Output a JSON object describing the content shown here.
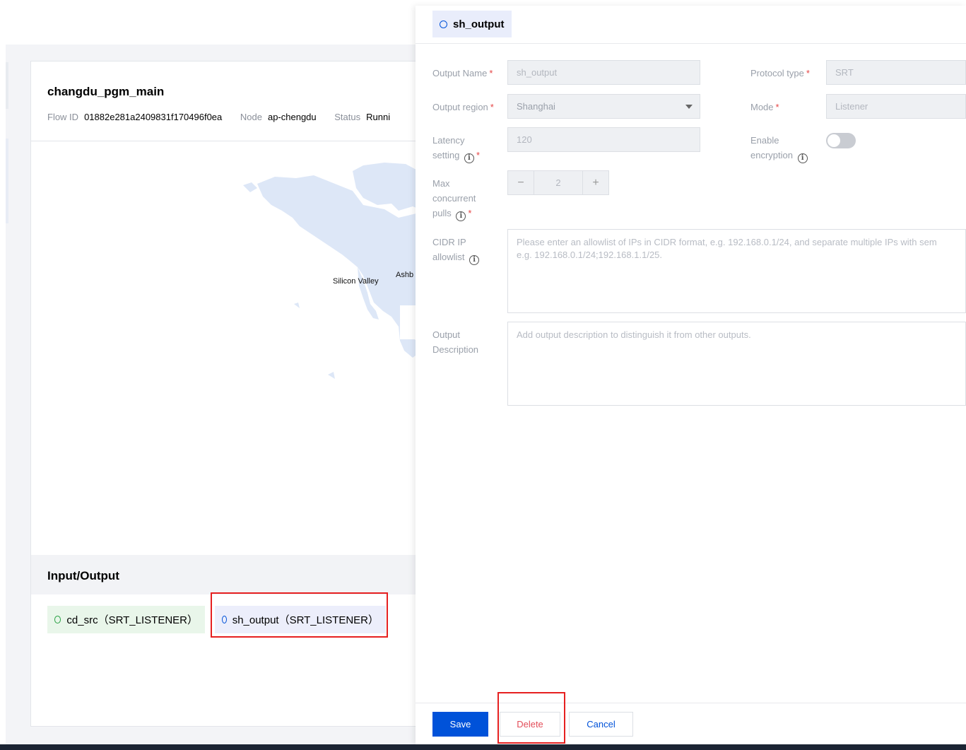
{
  "flow": {
    "title": "changdu_pgm_main",
    "flow_id_label": "Flow ID",
    "flow_id": "01882e281a2409831f170496f0ea",
    "node_label": "Node",
    "node": "ap-chengdu",
    "status_label": "Status",
    "status": "Runni"
  },
  "map": {
    "labels": [
      "Silicon Valley",
      "Ashb"
    ]
  },
  "io": {
    "title": "Input/Output",
    "input": "cd_src（SRT_LISTENER）",
    "output": "sh_output（SRT_LISTENER）"
  },
  "drawer": {
    "tab_label": "sh_output",
    "output_name_label": "Output Name",
    "output_name_value": "sh_output",
    "protocol_type_label": "Protocol type",
    "protocol_type_value": "SRT",
    "output_region_label": "Output region",
    "output_region_value": "Shanghai",
    "mode_label": "Mode",
    "mode_value": "Listener",
    "latency_label_1": "Latency",
    "latency_label_2": "setting",
    "latency_value": "120",
    "encryption_label_1": "Enable",
    "encryption_label_2": "encryption",
    "encryption_enabled": false,
    "max_pulls_label_1": "Max",
    "max_pulls_label_2": "concurrent",
    "max_pulls_label_3": "pulls",
    "max_pulls_minus": "−",
    "max_pulls_value": "2",
    "max_pulls_plus": "+",
    "cidr_label_1": "CIDR IP",
    "cidr_label_2": "allowlist",
    "cidr_placeholder_1": "Please enter an allowlist of IPs in CIDR format, e.g. 192.168.0.1/24, and separate multiple IPs with sem",
    "cidr_placeholder_2": "e.g. 192.168.0.1/24;192.168.1.1/25.",
    "desc_label_1": "Output",
    "desc_label_2": "Description",
    "desc_placeholder": "Add output description to distinguish it from other outputs.",
    "info_glyph": "i",
    "required_mark": "*"
  },
  "footer": {
    "save": "Save",
    "delete": "Delete",
    "cancel": "Cancel"
  },
  "colors": {
    "primary": "#0052d9",
    "danger": "#e34d59",
    "highlight": "#e62020",
    "input_chip": "#e9f6ea",
    "output_chip": "#eceefb"
  }
}
